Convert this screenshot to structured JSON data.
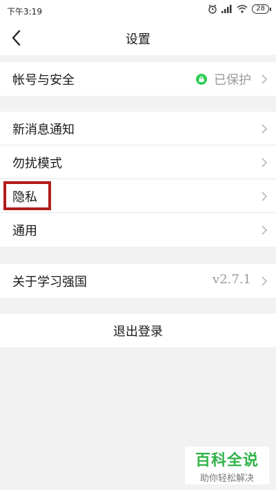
{
  "statusbar": {
    "time": "下午3:19",
    "battery": "28",
    "icons": [
      "alarm-icon",
      "signal-icon",
      "wifi-icon",
      "battery-icon"
    ]
  },
  "header": {
    "title": "设置",
    "back_icon": "chevron-left-icon"
  },
  "settings": {
    "account": {
      "label": "帐号与安全",
      "status": "已保护",
      "status_color": "#2ecc55"
    },
    "notifications": {
      "label": "新消息通知"
    },
    "dnd": {
      "label": "勿扰模式"
    },
    "privacy": {
      "label": "隐私",
      "highlight_color": "#b31b1b"
    },
    "general": {
      "label": "通用"
    },
    "about": {
      "label": "关于学习强国",
      "version": "v2.7.1"
    }
  },
  "logout": {
    "label": "退出登录"
  },
  "watermark": {
    "title": "百科全说",
    "subtitle": "助你轻松解决"
  },
  "colors": {
    "background": "#f2f2f2",
    "card": "#ffffff",
    "accent_green": "#2ecc55"
  }
}
